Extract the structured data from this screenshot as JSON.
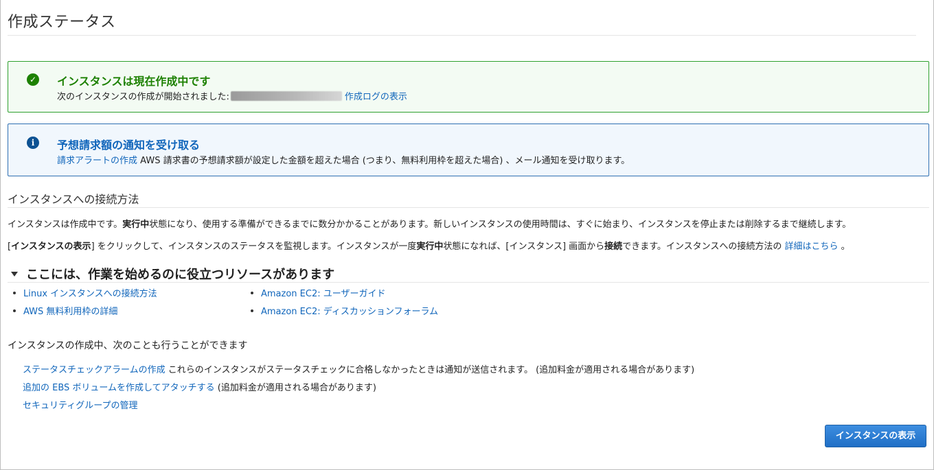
{
  "page": {
    "title": "作成ステータス"
  },
  "success_alert": {
    "heading": "インスタンスは現在作成中です",
    "body_text": "次のインスタンスの作成が開始されました:",
    "log_link": "作成ログの表示"
  },
  "info_alert": {
    "heading": "予想請求額の通知を受け取る",
    "link": "請求アラートの作成",
    "body_text": "AWS 請求書の予想請求額が設定した金額を超えた場合 (つまり、無料利用枠を超えた場合) 、メール通知を受け取ります。"
  },
  "connect": {
    "heading": "インスタンスへの接続方法",
    "p1_a": "インスタンスは作成中です。",
    "p1_b": "実行中",
    "p1_c": "状態になり、使用する準備ができるまでに数分かかることがあります。新しいインスタンスの使用時間は、すぐに始まり、インスタンスを停止または削除するまで継続します。",
    "p2_a": "[",
    "p2_b": "インスタンスの表示",
    "p2_c": "] をクリックして、インスタンスのステータスを監視します。インスタンスが一度",
    "p2_d": "実行中",
    "p2_e": "状態になれば、[インスタンス] 画面から",
    "p2_f": "接続",
    "p2_g": "できます。インスタンスへの接続方法の ",
    "p2_link": "詳細はこちら",
    "p2_h": " 。"
  },
  "resources": {
    "heading": "ここには、作業を始めるのに役立つリソースがあります",
    "items": [
      "Linux インスタンスへの接続方法",
      "AWS 無料利用枠の詳細",
      "Amazon EC2: ユーザーガイド",
      "Amazon EC2: ディスカッションフォーラム"
    ]
  },
  "also": {
    "heading": "インスタンスの作成中、次のことも行うことができます",
    "actions": [
      {
        "link": "ステータスチェックアラームの作成",
        "text": " これらのインスタンスがステータスチェックに合格しなかったときは通知が送信されます。 (追加料金が適用される場合があります)"
      },
      {
        "link": "追加の EBS ボリュームを作成してアタッチする",
        "text": " (追加料金が適用される場合があります)"
      },
      {
        "link": "セキュリティグループの管理",
        "text": ""
      }
    ]
  },
  "buttons": {
    "view_instances": "インスタンスの表示"
  },
  "colors": {
    "success": "#1d8102",
    "info": "#1166bb",
    "link": "#1166bb",
    "primary": "#1f6fc6"
  },
  "icons": {
    "success": "check-circle-icon",
    "info": "info-circle-icon",
    "caret": "caret-down-icon"
  }
}
